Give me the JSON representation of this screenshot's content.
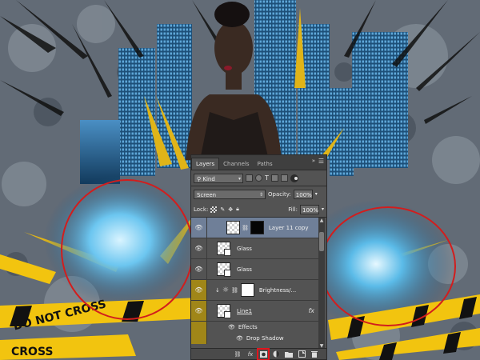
{
  "panel": {
    "tabs": [
      {
        "label": "Layers",
        "active": true
      },
      {
        "label": "Channels",
        "active": false
      },
      {
        "label": "Paths",
        "active": false
      }
    ],
    "filter": {
      "kind_label": "Kind"
    },
    "blend_mode": "Screen",
    "opacity": {
      "label": "Opacity:",
      "value": "100%"
    },
    "lock": {
      "label": "Lock:"
    },
    "fill": {
      "label": "Fill:",
      "value": "100%"
    },
    "layers": [
      {
        "name": "Layer 11 copy",
        "selected": true,
        "visible": true
      },
      {
        "name": "Glass",
        "selected": false,
        "visible": true
      },
      {
        "name": "Glass",
        "selected": false,
        "visible": true
      },
      {
        "name": "Brightness/...",
        "selected": false,
        "visible": true,
        "adjustment": true
      },
      {
        "name": "Line1",
        "selected": false,
        "visible": true,
        "has_fx": true
      }
    ],
    "effects_label": "Effects",
    "drop_shadow_label": "Drop Shadow",
    "fx_label": "fx",
    "bottom_icons": [
      "link-icon",
      "fx-icon",
      "add-mask-icon",
      "adjustment-icon",
      "group-folder-icon",
      "new-layer-icon",
      "trash-icon"
    ],
    "highlighted_icon": "add-mask-icon"
  },
  "artwork": {
    "tape_text_1": "DO NOT CROSS",
    "tape_text_2": "CROSS",
    "accent_colors": {
      "tape_yellow": "#f2c40f",
      "circle_red": "#d21d1d",
      "sky_blue": "#2f8cc8"
    }
  }
}
